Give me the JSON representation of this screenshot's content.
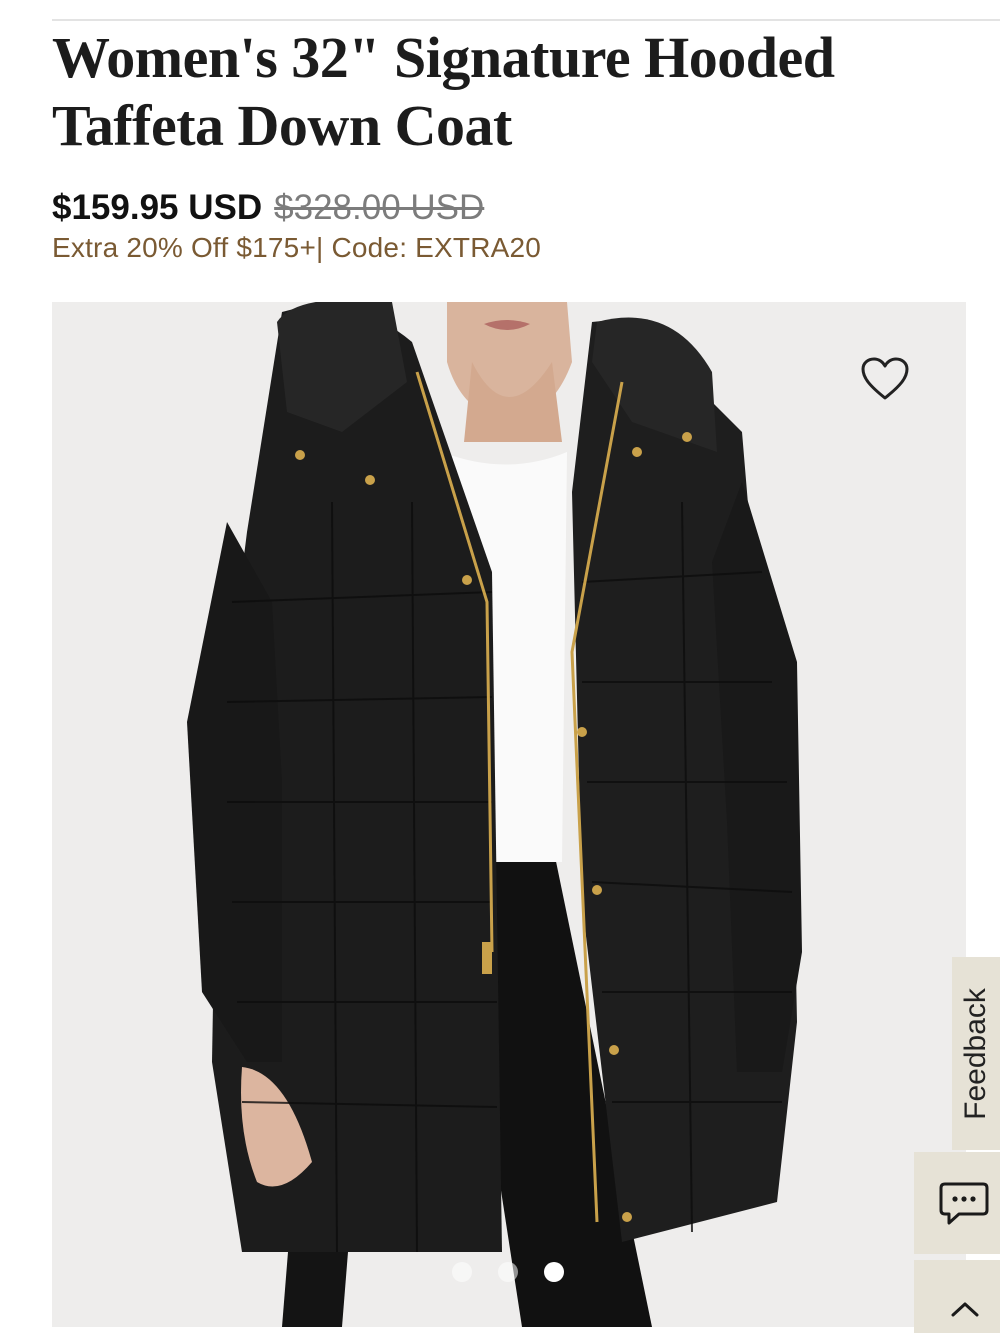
{
  "product": {
    "title": "Women's 32\" Signature Hooded Taffeta Down Coat",
    "price_sale": "$159.95 USD",
    "price_original": "$328.00 USD",
    "promo": "Extra 20% Off $175+| Code: EXTRA20"
  },
  "gallery": {
    "image_count": 3,
    "active_index": 2,
    "wishlist_icon": "heart-outline-icon"
  },
  "widgets": {
    "feedback_label": "Feedback",
    "chat_icon": "chat-bubble-icon",
    "scroll_top_icon": "chevron-up-icon"
  },
  "colors": {
    "promo_text": "#7a5a33",
    "widget_background": "#e6e2d6",
    "coat": "#1a1a1a"
  }
}
